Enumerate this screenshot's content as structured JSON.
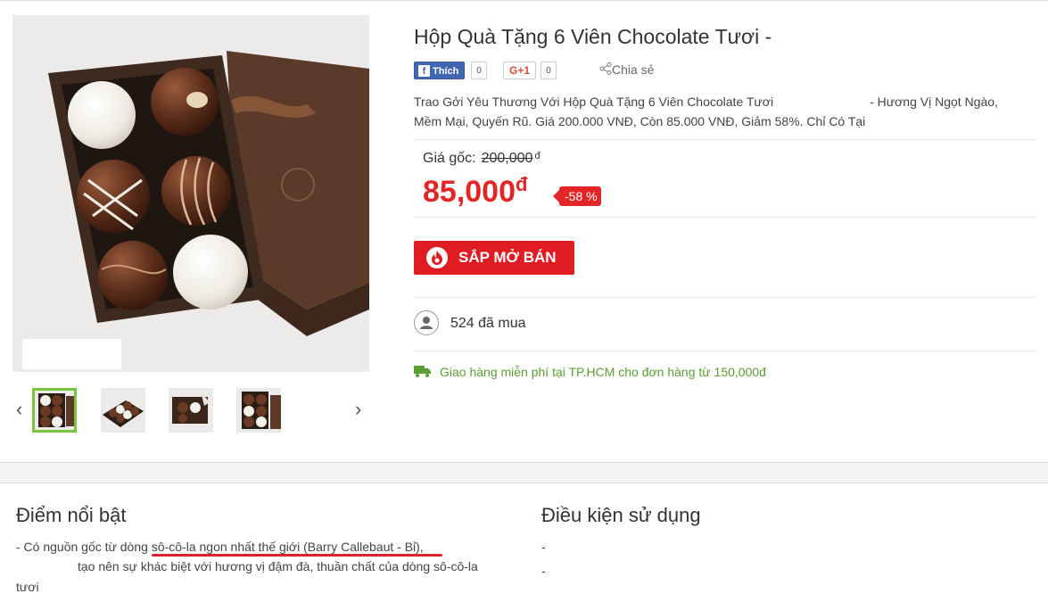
{
  "product": {
    "title": "Hộp Quà Tặng 6 Viên Chocolate Tươi -",
    "description_line1_a": "Trao Gởi Yêu Thương Với Hộp Quà Tặng 6 Viên Chocolate Tươi",
    "description_line1_b": "- Hương Vị Ngọt Ngào,",
    "description_line2": "Mềm Mại, Quyến Rũ. Giá 200.000 VNĐ, Còn 85.000 VNĐ, Giảm 58%. Chỉ Có Tại",
    "original_price_label": "Giá gốc:",
    "original_price": "200,000",
    "currency_symbol": "đ",
    "price": "85,000",
    "discount": "-58 %",
    "buy_button": "SẮP MỞ BÁN",
    "sold_count": "524 đã mua",
    "shipping": "Giao hàng miễn phí tại TP.HCM cho đơn hàng từ 150,000đ"
  },
  "social": {
    "fb_label": "Thích",
    "fb_count": "0",
    "gplus_label": "G+1",
    "gplus_count": "0",
    "share_label": "Chia sẻ"
  },
  "gallery": {
    "prev": "‹",
    "next": "›",
    "thumb_count": 4,
    "active_index": 0
  },
  "sections": {
    "highlights_title": "Điểm nổi bật",
    "highlights_line1_a": "- Có nguồn gốc từ dòng ",
    "highlights_line1_b": "sô-cô-la ngon nhất thế giới (Barry Callebaut - Bỉ),",
    "highlights_line2": "tạo nên sự khác biệt với hương vị đậm đà, thuần chất của dòng sô-cô-la",
    "highlights_line3": "tươi",
    "terms_title": "Điều kiện sử dụng",
    "terms_item1": "-",
    "terms_item2": "-"
  },
  "colors": {
    "price_red": "#e32526",
    "button_red": "#e11b22",
    "shipping_green": "#5a9e34",
    "active_thumb_border": "#7cc142"
  },
  "icons": [
    "fb-icon",
    "gplus-icon",
    "share-icon",
    "fire-icon",
    "user-icon",
    "truck-icon",
    "chevron-left-icon",
    "chevron-right-icon"
  ]
}
